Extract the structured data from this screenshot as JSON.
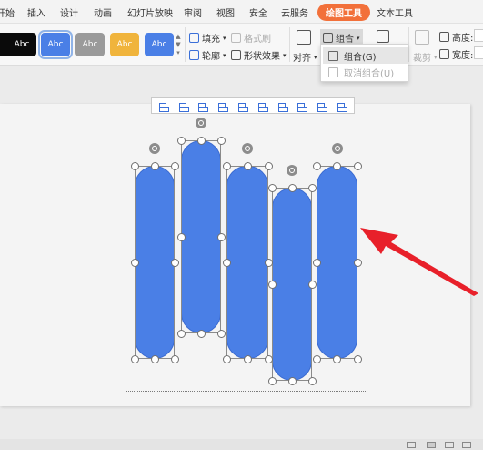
{
  "menu": {
    "items": [
      "开始",
      "插入",
      "设计",
      "动画",
      "幻灯片放映",
      "审阅",
      "视图",
      "安全",
      "云服务",
      "绘图工具",
      "文本工具"
    ],
    "active": "绘图工具"
  },
  "ribbon": {
    "styles": [
      {
        "label": "Abc",
        "color": "#0a0a0a"
      },
      {
        "label": "Abc",
        "color": "#4a7fe6"
      },
      {
        "label": "Abc",
        "color": "#9a9a9a"
      },
      {
        "label": "Abc",
        "color": "#f0b43c"
      },
      {
        "label": "Abc",
        "color": "#4a7fe6"
      }
    ],
    "fill_label": "填充",
    "format_painter_label": "格式刷",
    "outline_label": "轮廓",
    "shape_effects_label": "形状效果",
    "align_label": "对齐",
    "group_label": "组合",
    "crop_label": "裁剪",
    "height_label": "高度:",
    "width_label": "宽度:"
  },
  "dropdown": {
    "group_item": "组合(G)",
    "ungroup_item": "取消组合(U)"
  },
  "colors": {
    "accent": "#f2703a",
    "shape_fill": "#4a7fe6",
    "arrow": "#e8202a"
  }
}
